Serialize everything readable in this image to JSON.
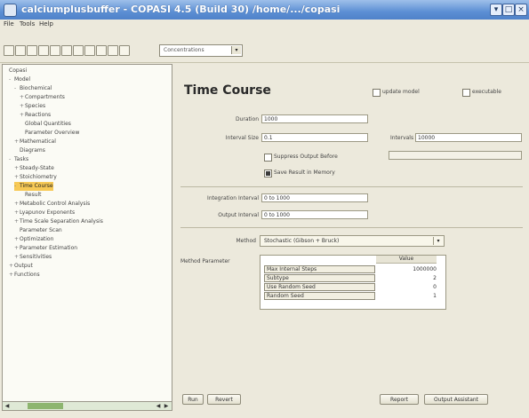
{
  "window": {
    "title": "calciumplusbuffer - COPASI 4.5 (Build 30) /home/.../copasi"
  },
  "menubar": {
    "items": [
      "File",
      "Tools",
      "Help"
    ]
  },
  "toolbar": {
    "combo_value": "Concentrations"
  },
  "tree": {
    "nodes": [
      {
        "label": "Copasi",
        "depth": 0,
        "expander": ""
      },
      {
        "label": "Model",
        "depth": 1,
        "expander": "-"
      },
      {
        "label": "Biochemical",
        "depth": 2,
        "expander": "-"
      },
      {
        "label": "Compartments",
        "depth": 3,
        "expander": "+"
      },
      {
        "label": "Species",
        "depth": 3,
        "expander": "+"
      },
      {
        "label": "Reactions",
        "depth": 3,
        "expander": "+"
      },
      {
        "label": "Global Quantities",
        "depth": 3,
        "expander": ""
      },
      {
        "label": "Parameter Overview",
        "depth": 3,
        "expander": ""
      },
      {
        "label": "Mathematical",
        "depth": 2,
        "expander": "+"
      },
      {
        "label": "Diagrams",
        "depth": 2,
        "expander": ""
      },
      {
        "label": "Tasks",
        "depth": 1,
        "expander": "-"
      },
      {
        "label": "Steady-State",
        "depth": 2,
        "expander": "+"
      },
      {
        "label": "Stoichiometry",
        "depth": 2,
        "expander": "+"
      },
      {
        "label": "Time Course",
        "depth": 2,
        "expander": "-",
        "selected": true
      },
      {
        "label": "Result",
        "depth": 3,
        "expander": ""
      },
      {
        "label": "Metabolic Control Analysis",
        "depth": 2,
        "expander": "+"
      },
      {
        "label": "Lyapunov Exponents",
        "depth": 2,
        "expander": "+"
      },
      {
        "label": "Time Scale Separation Analysis",
        "depth": 2,
        "expander": "+"
      },
      {
        "label": "Parameter Scan",
        "depth": 2,
        "expander": ""
      },
      {
        "label": "Optimization",
        "depth": 2,
        "expander": "+"
      },
      {
        "label": "Parameter Estimation",
        "depth": 2,
        "expander": "+"
      },
      {
        "label": "Sensitivities",
        "depth": 2,
        "expander": "+"
      },
      {
        "label": "Output",
        "depth": 1,
        "expander": "+"
      },
      {
        "label": "Functions",
        "depth": 1,
        "expander": "+"
      }
    ]
  },
  "main": {
    "title": "Time Course",
    "update_model_label": "update model",
    "executable_label": "executable",
    "duration_label": "Duration",
    "duration_value": "1000",
    "interval_size_label": "Interval Size",
    "interval_size_value": "0.1",
    "intervals_label": "Intervals",
    "intervals_value": "10000",
    "suppress_label": "Suppress Output Before",
    "save_memory_label": "Save Result in Memory",
    "integration_interval_label": "Integration Interval",
    "integration_interval_value": "0 to 1000",
    "output_interval_label": "Output Interval",
    "output_interval_value": "0 to 1000",
    "method_label": "Method",
    "method_value": "Stochastic (Gibson + Bruck)",
    "method_param_label": "Method Parameter",
    "params_header": "Value",
    "params": [
      {
        "name": "Max Internal Steps",
        "value": "1000000"
      },
      {
        "name": "Subtype",
        "value": "2"
      },
      {
        "name": "Use Random Seed",
        "value": "0"
      },
      {
        "name": "Random Seed",
        "value": "1"
      }
    ],
    "buttons": {
      "run": "Run",
      "revert": "Revert",
      "report": "Report",
      "output_assistant": "Output Assistant"
    }
  },
  "colors": {
    "title_bar": "#5c8fd4",
    "selection": "#f7c955",
    "background": "#ece9dc"
  }
}
